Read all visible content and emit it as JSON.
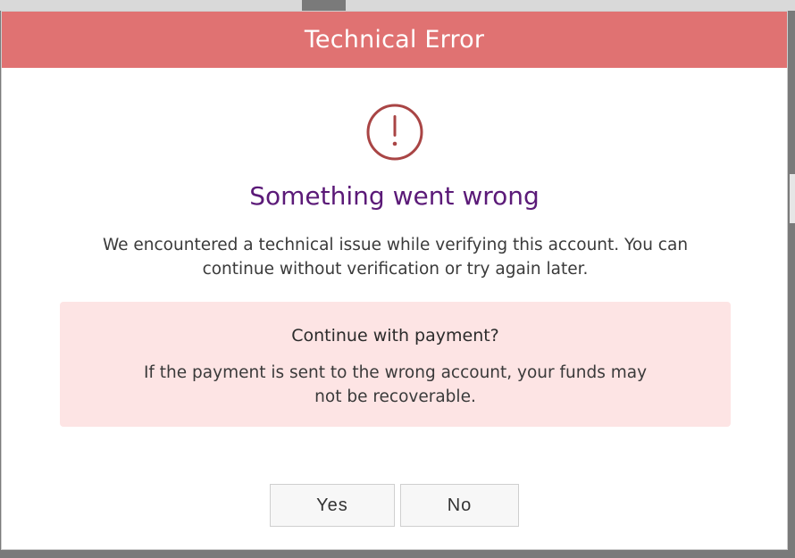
{
  "dialog": {
    "title": "Technical Error",
    "heading": "Something went wrong",
    "message_line1": "We encountered a technical issue while verifying this account. You can",
    "message_line2": "continue without verification or try again later.",
    "icon": "exclamation-circle-icon",
    "warning": {
      "title": "Continue with payment?",
      "text_line1": "If the payment is sent to the wrong account, your funds may",
      "text_line2": "not be recoverable."
    },
    "buttons": {
      "yes_label": "Yes",
      "no_label": "No"
    }
  },
  "colors": {
    "header_bg": "#e07272",
    "heading": "#5b1a78",
    "warning_bg": "#fde4e4",
    "icon": "#a94545"
  }
}
